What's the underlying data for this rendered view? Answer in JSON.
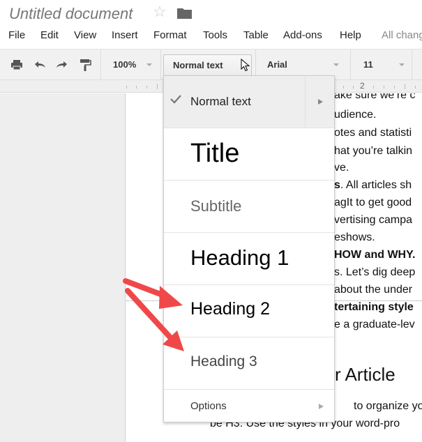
{
  "document": {
    "title": "Untitled document"
  },
  "menubar": {
    "items": [
      "File",
      "Edit",
      "View",
      "Insert",
      "Format",
      "Tools",
      "Table",
      "Add-ons",
      "Help"
    ],
    "status": "All changes saved in Drive"
  },
  "toolbar": {
    "zoom": "100%",
    "paragraph_style": "Normal text",
    "font": "Arial",
    "font_size": "11"
  },
  "ruler": {
    "label": "2"
  },
  "style_menu": {
    "items": [
      {
        "label": "Normal text",
        "selected": true,
        "has_submenu": true
      },
      {
        "label": "Title"
      },
      {
        "label": "Subtitle"
      },
      {
        "label": "Heading 1"
      },
      {
        "label": "Heading 2"
      },
      {
        "label": "Heading 3"
      },
      {
        "label": "Options",
        "has_submenu": true
      }
    ]
  },
  "page_text": {
    "lines": [
      "ake sure we’re c",
      "udience.",
      "otes and statisti",
      "hat you’re talkin",
      "ve.",
      "s. All articles sh",
      "agIt to get good",
      "vertising campa",
      "eshows.",
      "HOW and WHY.",
      "s. Let’s dig deep",
      "about the under",
      "tertaining style",
      "e a graduate-lev"
    ],
    "bold_prefix_line6": "s",
    "bold_line10": "HOW and WHY.",
    "bold_line13": "tertaining style",
    "heading": "r Article",
    "after_heading_1": "to organize you",
    "after_heading_2": "be H3. Use the styles in your word-pro"
  },
  "annotation": {
    "arrow_color": "#f04848"
  }
}
